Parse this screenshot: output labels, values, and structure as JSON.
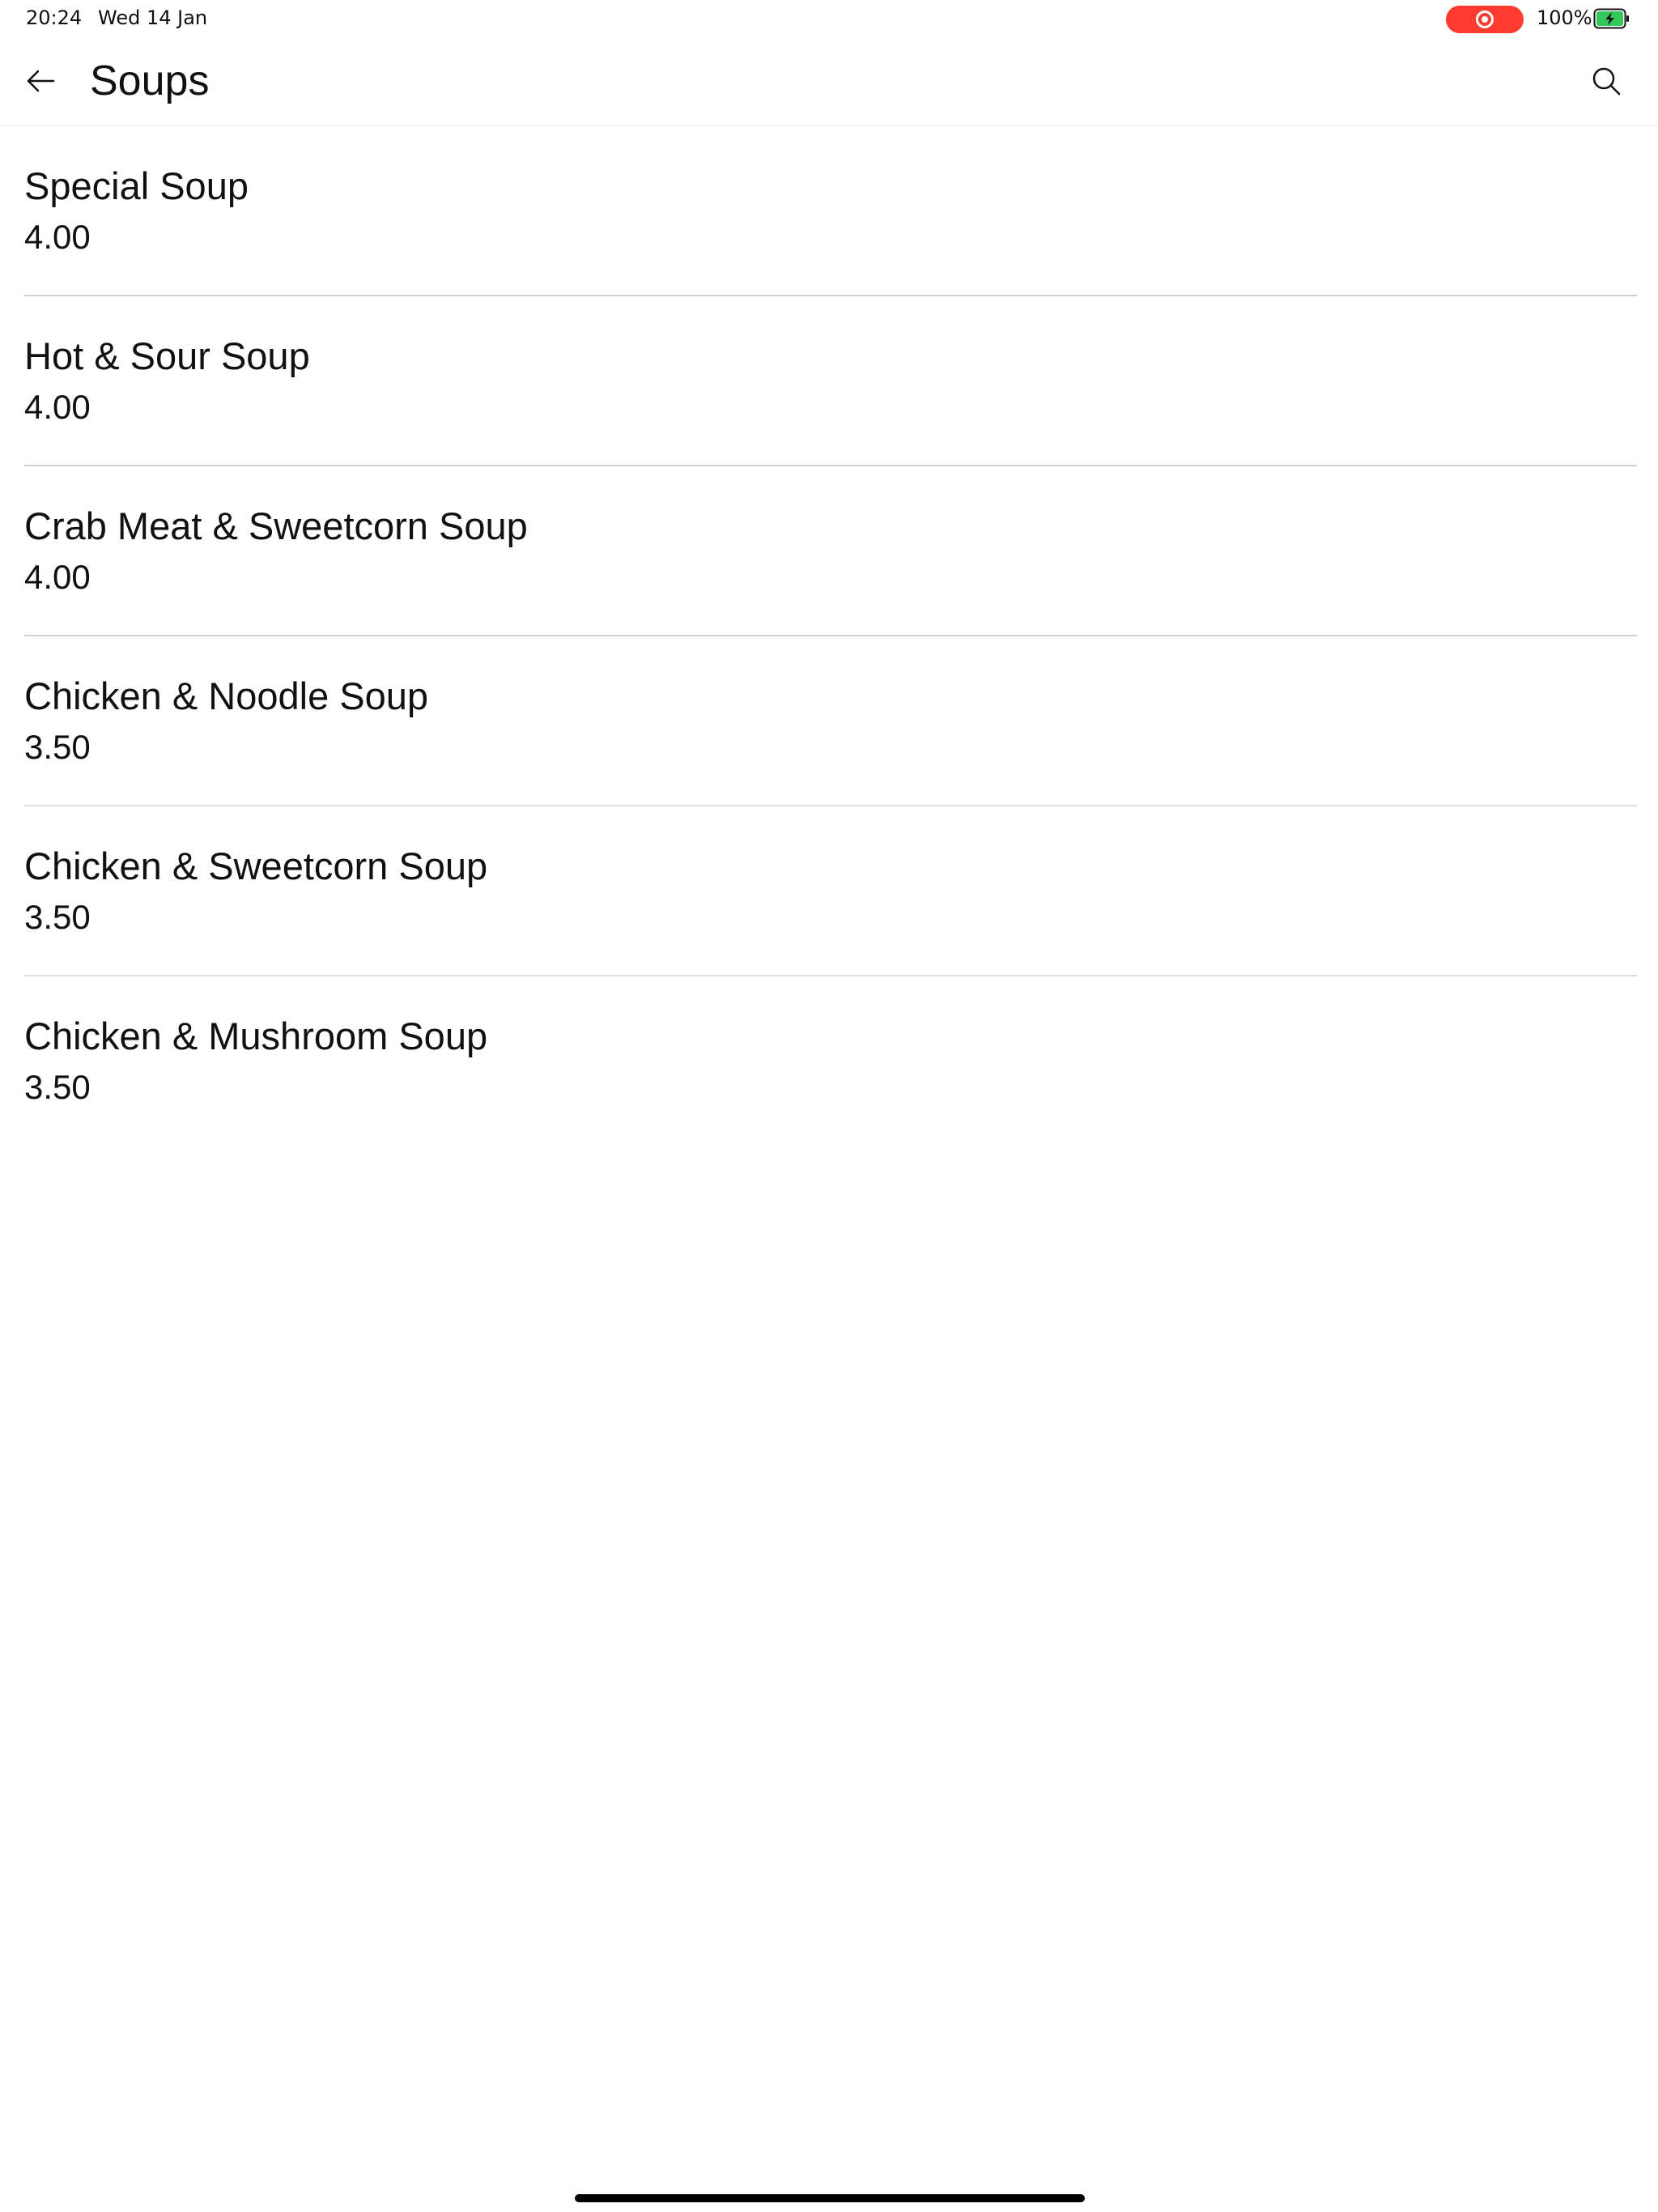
{
  "status_bar": {
    "time": "20:24",
    "date": "Wed 14 Jan",
    "battery_percent": "100%",
    "record_color": "#ff3b30",
    "battery_color": "#34c759",
    "battery_level": 1.0
  },
  "nav": {
    "title": "Soups",
    "back_icon": "arrow-left-icon",
    "search_icon": "search-icon"
  },
  "items": [
    {
      "name": "Special Soup",
      "price": "4.00"
    },
    {
      "name": "Hot & Sour Soup",
      "price": "4.00"
    },
    {
      "name": "Crab Meat & Sweetcorn Soup",
      "price": "4.00"
    },
    {
      "name": "Chicken & Noodle Soup",
      "price": "3.50"
    },
    {
      "name": "Chicken & Sweetcorn Soup",
      "price": "3.50"
    },
    {
      "name": "Chicken & Mushroom Soup",
      "price": "3.50"
    }
  ]
}
